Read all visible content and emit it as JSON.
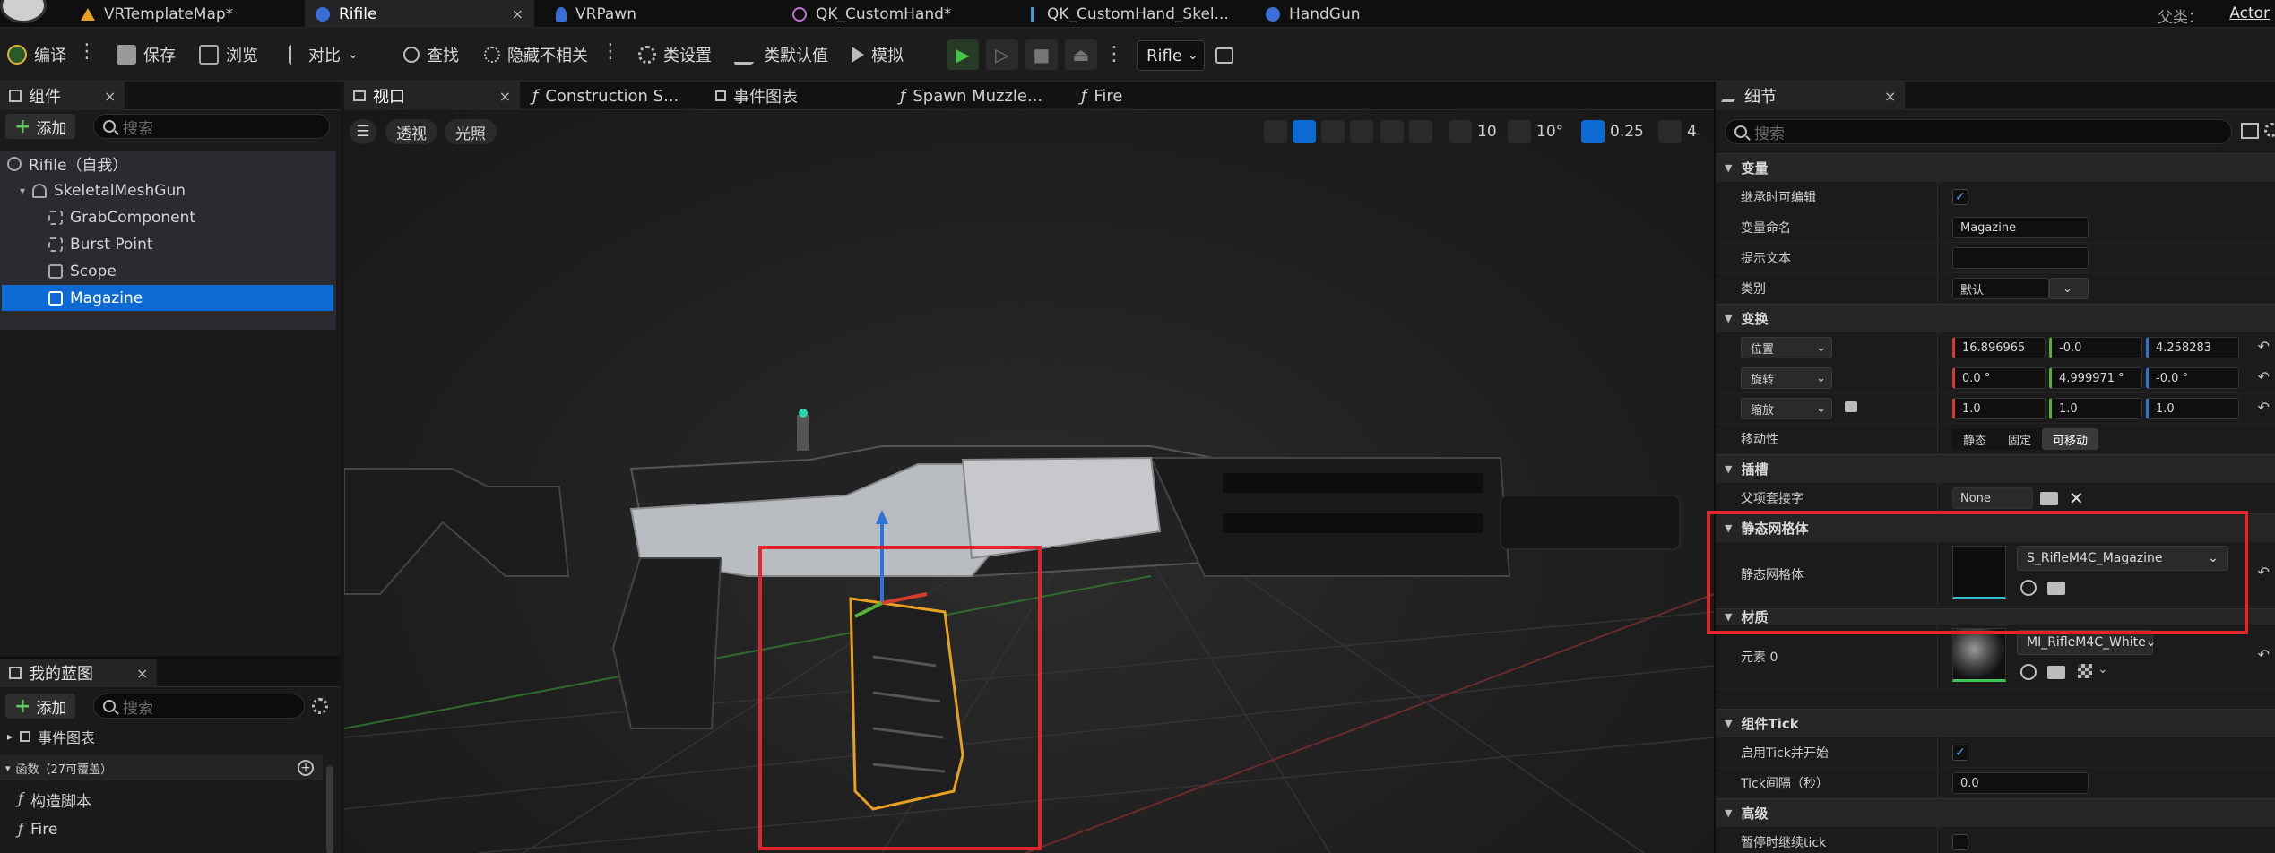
{
  "tabs": [
    {
      "label": "VRTemplateMap*",
      "icon": "level-icon"
    },
    {
      "label": "Rifile",
      "icon": "blueprint-icon",
      "active": true
    },
    {
      "label": "VRPawn",
      "icon": "pawn-icon"
    },
    {
      "label": "QK_CustomHand*",
      "icon": "anim-icon"
    },
    {
      "label": "QK_CustomHand_Skel...",
      "icon": "skeleton-icon"
    },
    {
      "label": "HandGun",
      "icon": "blueprint-icon"
    }
  ],
  "tab_close": "×",
  "parent_class": {
    "label": "父类：",
    "value": "Actor"
  },
  "toolbar": {
    "compile": "编译",
    "save": "保存",
    "browse": "浏览",
    "diff": "对比",
    "find": "查找",
    "hide_unrelated": "隐藏不相关",
    "class_settings": "类设置",
    "class_defaults": "类默认值",
    "simulate": "模拟",
    "debug_object": "Rifle"
  },
  "components_panel": {
    "title": "组件",
    "add_label": "添加",
    "search_placeholder": "搜索",
    "items": [
      {
        "label": "Rifile（自我）",
        "level": 0
      },
      {
        "label": "SkeletalMeshGun",
        "level": 1
      },
      {
        "label": "GrabComponent",
        "level": 2
      },
      {
        "label": "Burst Point",
        "level": 2
      },
      {
        "label": "Scope",
        "level": 2
      },
      {
        "label": "Magazine",
        "level": 2,
        "selected": true
      }
    ]
  },
  "my_blueprint_panel": {
    "title": "我的蓝图",
    "add_label": "添加",
    "search_placeholder": "搜索",
    "event_graph": "事件图表",
    "functions_header": "函数（27可覆盖）",
    "functions": [
      "构造脚本",
      "Fire"
    ]
  },
  "viewport_tabs": [
    {
      "label": "视口",
      "active": true
    },
    {
      "label": "Construction S..."
    },
    {
      "label": "事件图表"
    },
    {
      "label": "Spawn Muzzle..."
    },
    {
      "label": "Fire"
    }
  ],
  "viewport": {
    "perspective": "透视",
    "lighting": "光照",
    "grid_snap": "10",
    "rotation_snap": "10°",
    "scale_snap": "0.25",
    "camera_speed": "4"
  },
  "details_panel": {
    "title": "细节",
    "search_placeholder": "搜索",
    "sections": {
      "variable": "变量",
      "transform": "变换",
      "sockets": "插槽",
      "static_mesh": "静态网格体",
      "materials": "材质",
      "component_tick": "组件Tick",
      "advanced": "高级"
    },
    "variable": {
      "editable_label": "继承时可编辑",
      "name_label": "变量命名",
      "name_value": "Magazine",
      "tooltip_label": "提示文本",
      "tooltip_value": "",
      "category_label": "类别",
      "category_value": "默认"
    },
    "transform": {
      "location_label": "位置",
      "location": [
        "16.896965",
        "-0.0",
        "4.258283"
      ],
      "rotation_label": "旋转",
      "rotation": [
        "0.0 °",
        "4.999971 °",
        "-0.0 °"
      ],
      "scale_label": "缩放",
      "scale": [
        "1.0",
        "1.0",
        "1.0"
      ],
      "mobility_label": "移动性",
      "mobility_options": [
        "静态",
        "固定",
        "可移动"
      ],
      "mobility_selected": "可移动"
    },
    "sockets": {
      "parent_socket_label": "父项套接字",
      "parent_socket_value": "None"
    },
    "static_mesh": {
      "label": "静态网格体",
      "value": "S_RifleM4C_Magazine"
    },
    "materials": {
      "element_label": "元素 0",
      "value": "MI_RifleM4C_White"
    },
    "component_tick": {
      "start_label": "启用Tick并开始",
      "interval_label": "Tick间隔（秒）",
      "interval_value": "0.0"
    },
    "advanced": {
      "pause_label": "暂停时继续tick"
    }
  },
  "colors": {
    "accent": "#0e6ad3",
    "highlight": "#e0262a",
    "play_green": "#47c447"
  }
}
